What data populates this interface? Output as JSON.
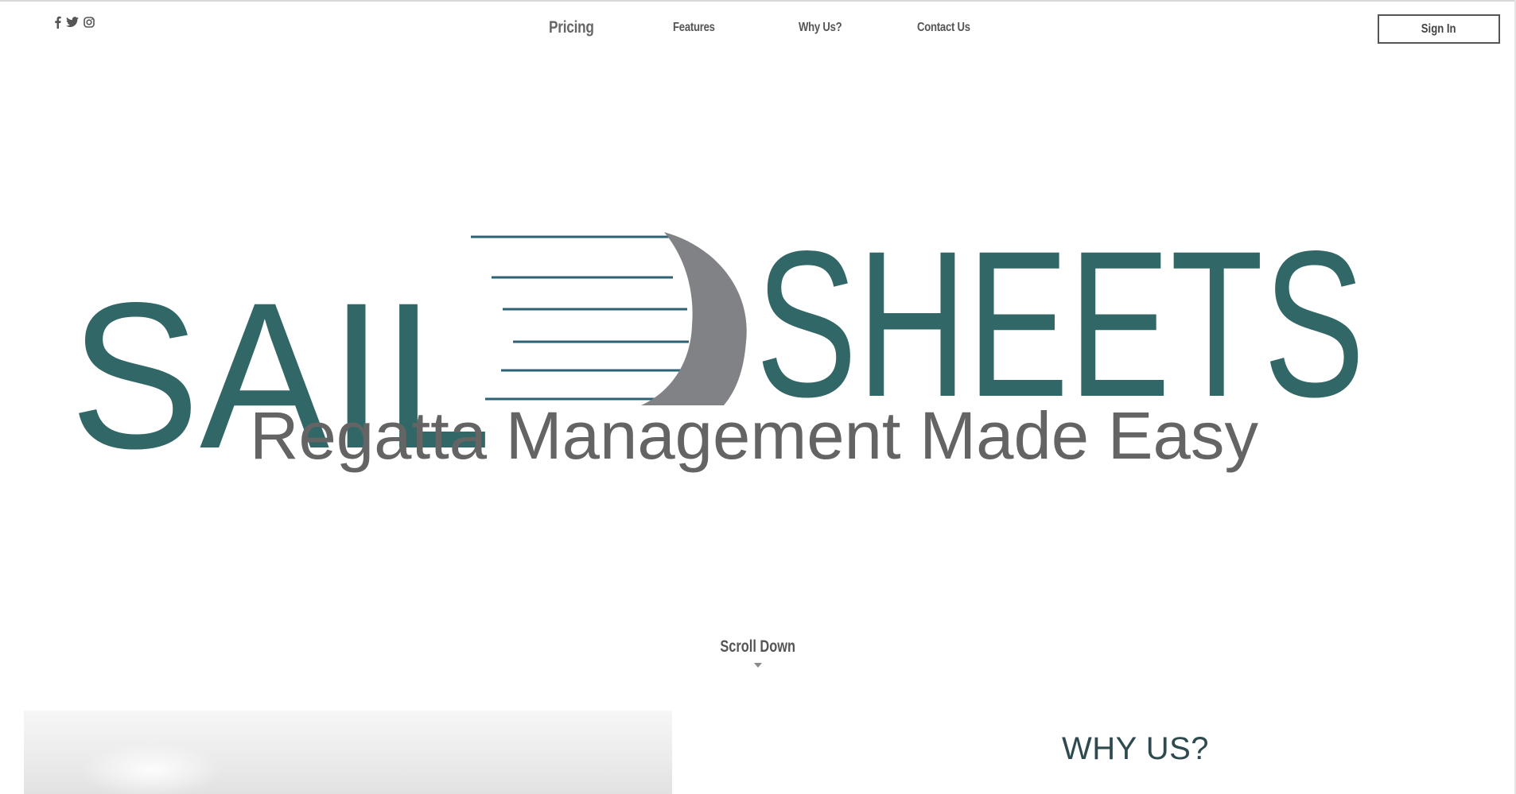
{
  "social": {
    "icons": [
      "facebook-icon",
      "twitter-icon",
      "instagram-icon"
    ]
  },
  "nav": {
    "items": [
      {
        "label": "Pricing"
      },
      {
        "label": "Features"
      },
      {
        "label": "Why Us?"
      },
      {
        "label": "Contact Us"
      }
    ]
  },
  "header": {
    "signin_label": "Sign In"
  },
  "logo": {
    "word_left": "SAIL",
    "word_right": "SHEETS",
    "tagline": "Regatta Management Made Easy",
    "colors": {
      "teal": "#316766",
      "gray_text": "#646464",
      "sail": "#818286",
      "lines": "#2d6275"
    }
  },
  "hero": {
    "scroll_label": "Scroll Down"
  },
  "section": {
    "heading": "WHY US?"
  }
}
